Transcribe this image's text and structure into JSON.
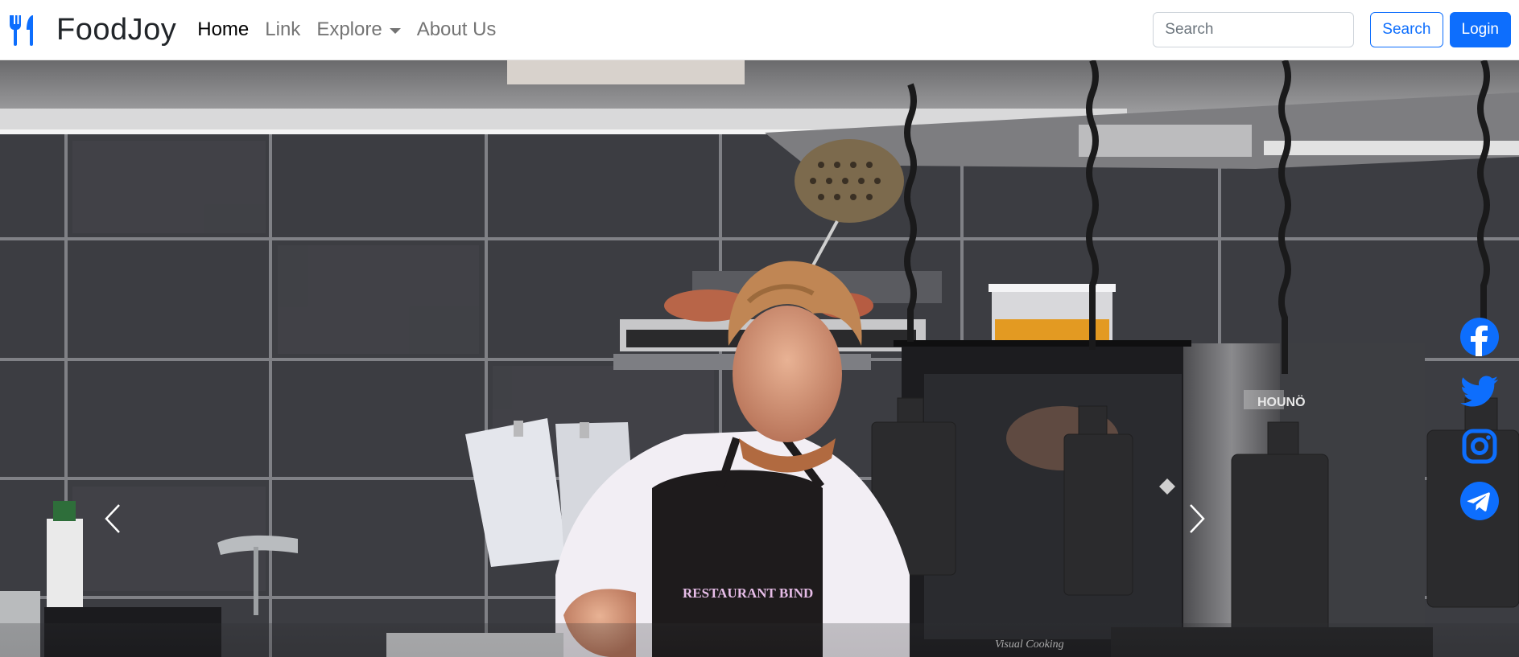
{
  "brand": {
    "name": "FoodJoy",
    "icon": "fork-knife-icon"
  },
  "nav": {
    "items": [
      {
        "label": "Home",
        "active": true
      },
      {
        "label": "Link",
        "active": false
      },
      {
        "label": "Explore",
        "active": false,
        "dropdown": true
      },
      {
        "label": "About Us",
        "active": false
      }
    ]
  },
  "search": {
    "placeholder": "Search",
    "value": "",
    "button_label": "Search"
  },
  "login": {
    "label": "Login"
  },
  "hero": {
    "apron_text": "RESTAURANT BIND",
    "oven_brand": "HOUNÖ",
    "corner_watermark": "Visual Cooking",
    "prev_icon": "chevron-left-icon",
    "next_icon": "chevron-right-icon"
  },
  "social": [
    "facebook-icon",
    "twitter-icon",
    "instagram-icon",
    "telegram-icon"
  ],
  "colors": {
    "accent": "#0d6efd",
    "nav_active": "#000000",
    "nav_muted": "#6c6c6c"
  }
}
